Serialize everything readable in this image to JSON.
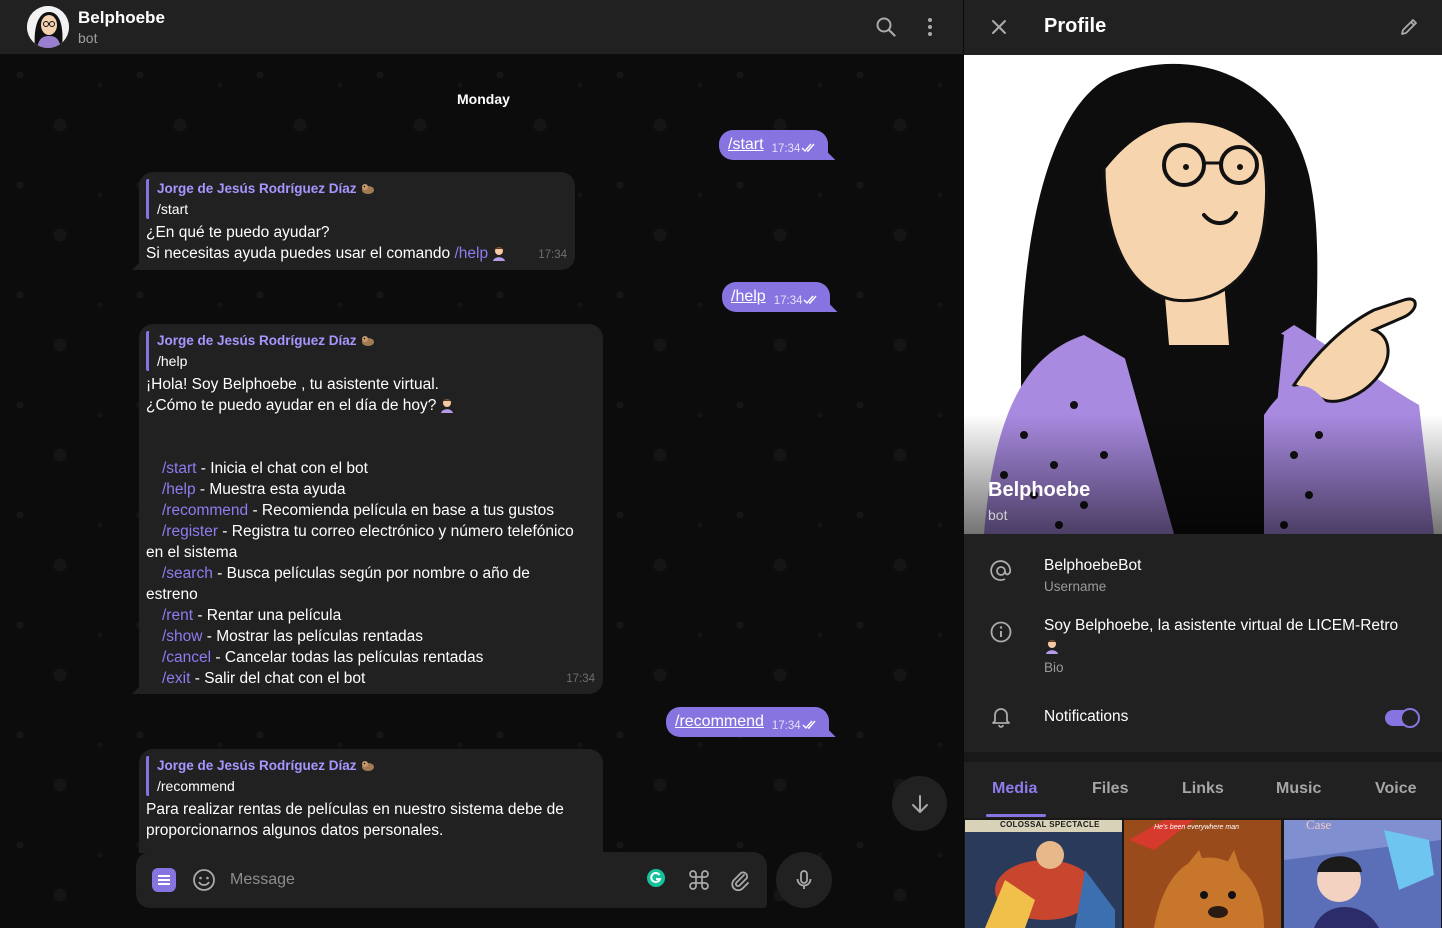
{
  "chat": {
    "title": "Belphoebe",
    "subtitle": "bot",
    "date": "Monday",
    "outgoing": [
      {
        "text": "/start",
        "time": "17:34"
      },
      {
        "text": "/help",
        "time": "17:34"
      },
      {
        "text": "/recommend",
        "time": "17:34"
      }
    ],
    "msg1": {
      "reply_name": "Jorge de Jesús Rodríguez Díaz",
      "reply_text": "/start",
      "line1": "¿En qué te puedo ayudar?",
      "line2_pre": "Si necesitas ayuda puedes usar el comando ",
      "line2_link": "/help",
      "time": "17:34"
    },
    "msg2": {
      "reply_name": "Jorge de Jesús Rodríguez Díaz",
      "reply_text": "/help",
      "line1": "¡Hola! Soy Belphoebe , tu asistente virtual.",
      "line2": "¿Cómo te puedo ayudar en el día de hoy?",
      "commands": [
        {
          "cmd": "/start",
          "desc": " - Inicia el chat con el bot"
        },
        {
          "cmd": "/help",
          "desc": " - Muestra esta ayuda"
        },
        {
          "cmd": "/recommend",
          "desc": " - Recomienda película en base a tus gustos"
        },
        {
          "cmd": "/register",
          "desc": " - Registra tu correo electrónico y número telefónico en el sistema"
        },
        {
          "cmd": "/search",
          "desc": " - Busca películas según por nombre o año de estreno"
        },
        {
          "cmd": "/rent",
          "desc": " - Rentar una película"
        },
        {
          "cmd": "/show",
          "desc": " - Mostrar las películas rentadas"
        },
        {
          "cmd": "/cancel",
          "desc": " - Cancelar todas las películas rentadas"
        },
        {
          "cmd": "/exit",
          "desc": " - Salir del chat con el bot"
        }
      ],
      "time": "17:34"
    },
    "msg3": {
      "reply_name": "Jorge de Jesús Rodríguez Díaz",
      "reply_text": "/recommend",
      "text": "Para realizar rentas de películas en nuestro sistema debe de proporcionarnos algunos datos personales."
    },
    "composer_placeholder": "Message"
  },
  "profile": {
    "title": "Profile",
    "name": "Belphoebe",
    "subtitle": "bot",
    "username": "BelphoebeBot",
    "username_label": "Username",
    "bio": "Soy Belphoebe, la asistente virtual de LICEM-Retro",
    "bio_label": "Bio",
    "notifications_label": "Notifications",
    "notifications_on": true,
    "tabs": [
      "Media",
      "Files",
      "Links",
      "Music",
      "Voice"
    ],
    "active_tab": "Media",
    "thumb1_caption": "COLOSSAL SPECTACLE",
    "thumb2_caption": "He's been everywhere man",
    "thumb3_caption": "Case"
  },
  "colors": {
    "accent": "#8774e1",
    "link": "#8e7cf0",
    "bubble_in": "#212121",
    "panel": "#212121"
  }
}
